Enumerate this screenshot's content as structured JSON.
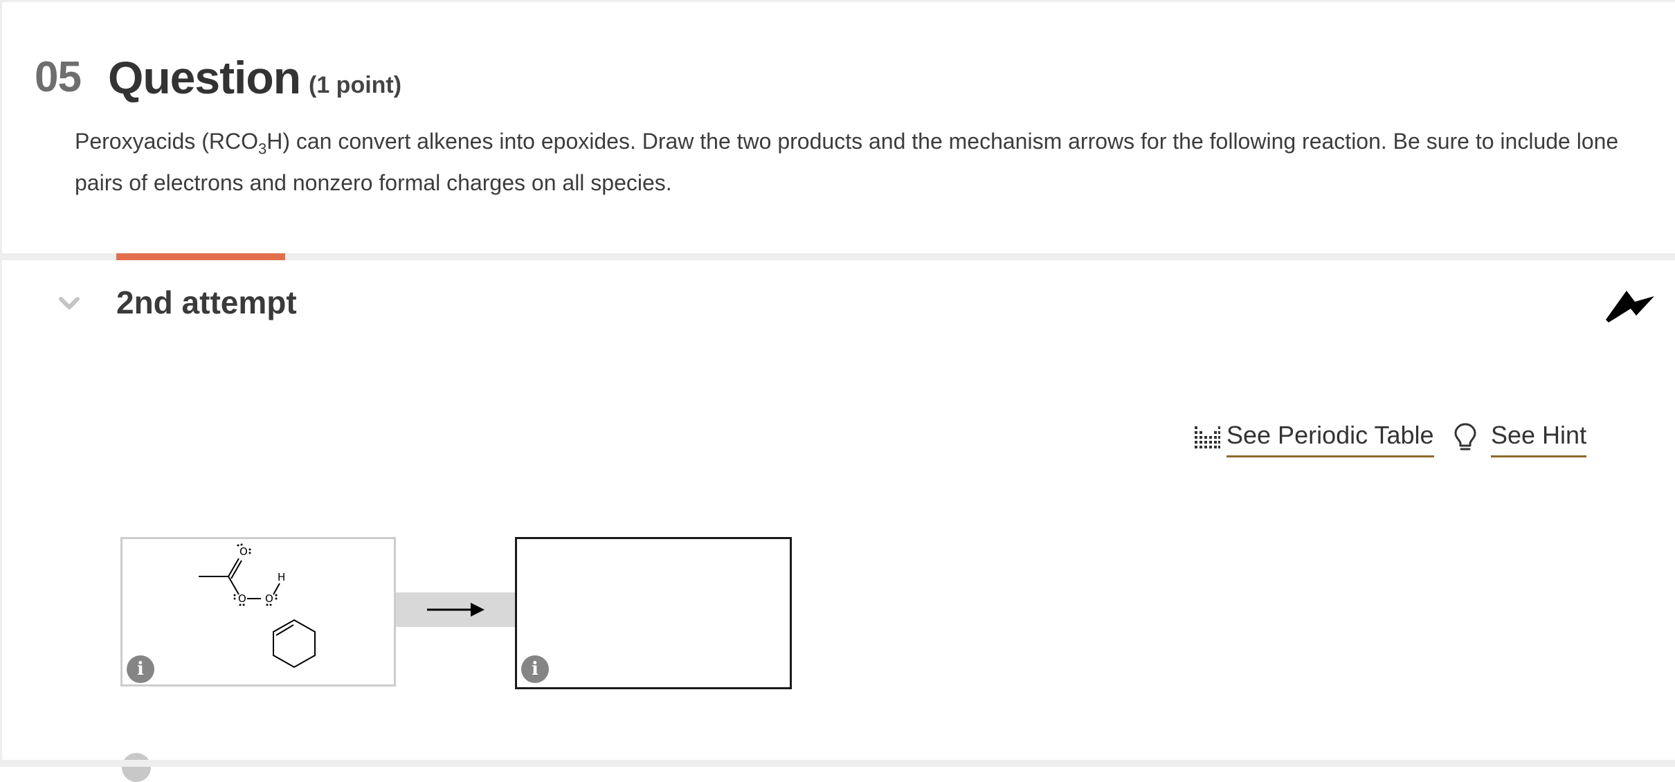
{
  "question": {
    "number": "05",
    "title": "Question",
    "points": "(1 point)",
    "prompt_before_sub": "Peroxyacids (RCO",
    "prompt_sub": "3",
    "prompt_after_sub": "H) can convert alkenes into epoxides. Draw the two products and the mechanism arrows for the following reaction. Be sure to include lone pairs of electrons and nonzero formal charges on all species."
  },
  "attempt": {
    "label": "2nd attempt",
    "accent_color": "#e2704d"
  },
  "tools": {
    "periodic_table_label": "See Periodic Table",
    "periodic_table_icon": "periodic-table-icon",
    "hint_label": "See Hint",
    "hint_icon": "lightbulb-icon"
  },
  "reaction": {
    "reactant_atom_labels": [
      "O",
      "O",
      "O",
      "H"
    ],
    "reactant_molecules": [
      "peroxyacetic acid",
      "cyclohexene"
    ],
    "info_icon_glyph": "i"
  }
}
